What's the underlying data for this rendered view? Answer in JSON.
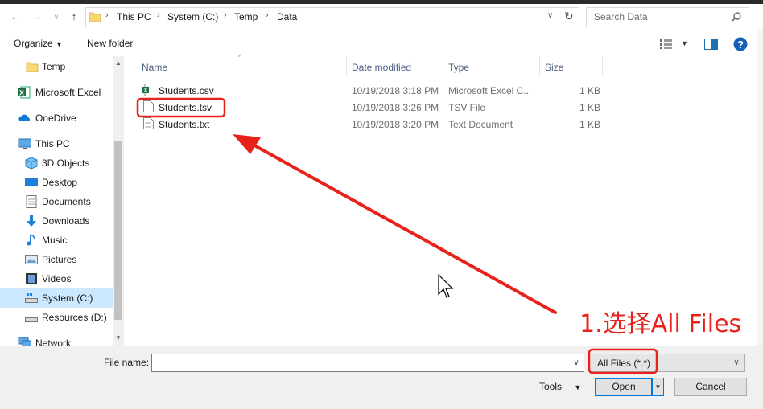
{
  "address": {
    "crumbs": [
      "This PC",
      "System (C:)",
      "Temp",
      "Data"
    ],
    "search_placeholder": "Search Data"
  },
  "toolbar": {
    "organize_label": "Organize",
    "new_folder_label": "New folder"
  },
  "nav_pane": {
    "items": [
      {
        "label": "Temp",
        "icon": "folder-icon"
      },
      {
        "label": "Microsoft Excel",
        "icon": "excel-icon"
      },
      {
        "label": "OneDrive",
        "icon": "cloud-icon"
      },
      {
        "label": "This PC",
        "icon": "computer-icon"
      },
      {
        "label": "3D Objects",
        "icon": "cube-icon"
      },
      {
        "label": "Desktop",
        "icon": "desktop-icon"
      },
      {
        "label": "Documents",
        "icon": "documents-icon"
      },
      {
        "label": "Downloads",
        "icon": "download-icon"
      },
      {
        "label": "Music",
        "icon": "music-icon"
      },
      {
        "label": "Pictures",
        "icon": "pictures-icon"
      },
      {
        "label": "Videos",
        "icon": "video-icon"
      },
      {
        "label": "System (C:)",
        "icon": "drive-icon",
        "selected": true
      },
      {
        "label": "Resources (D:)",
        "icon": "drive-icon"
      },
      {
        "label": "Network",
        "icon": "network-icon"
      }
    ]
  },
  "file_list": {
    "columns": [
      "Name",
      "Date modified",
      "Type",
      "Size"
    ],
    "rows": [
      {
        "name": "Students.csv",
        "date": "10/19/2018 3:18 PM",
        "type": "Microsoft Excel C...",
        "size": "1 KB",
        "icon": "excel-csv-icon"
      },
      {
        "name": "Students.tsv",
        "date": "10/19/2018 3:26 PM",
        "type": "TSV File",
        "size": "1 KB",
        "icon": "blank-file-icon"
      },
      {
        "name": "Students.txt",
        "date": "10/19/2018 3:20 PM",
        "type": "Text Document",
        "size": "1 KB",
        "icon": "text-file-icon"
      }
    ]
  },
  "bottom": {
    "filename_label": "File name:",
    "filename_value": "",
    "filter_value": "All Files (*.*)",
    "tools_label": "Tools",
    "open_label": "Open",
    "cancel_label": "Cancel"
  },
  "annotation": {
    "text": "1.选择All Files",
    "color": "#e8221b"
  }
}
